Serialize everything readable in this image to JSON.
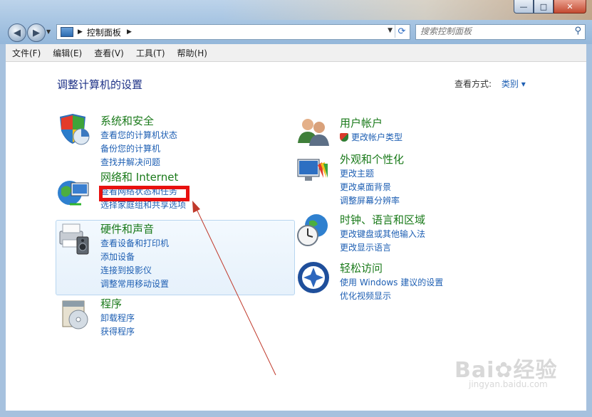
{
  "address": {
    "breadcrumb": "控制面板",
    "search_placeholder": "搜索控制面板"
  },
  "window_buttons": {
    "minimize": "—",
    "maximize": "□",
    "close": "✕"
  },
  "menu": [
    "文件(F)",
    "编辑(E)",
    "查看(V)",
    "工具(T)",
    "帮助(H)"
  ],
  "header": {
    "title": "调整计算机的设置",
    "view_by_label": "查看方式:",
    "view_by_value": "类别 ▾"
  },
  "categories_left": [
    {
      "title": "系统和安全",
      "icon": "shield-chart-icon",
      "links": [
        "查看您的计算机状态",
        "备份您的计算机",
        "查找并解决问题"
      ]
    },
    {
      "title": "网络和 Internet",
      "icon": "globe-network-icon",
      "links": [
        "查看网络状态和任务",
        "选择家庭组和共享选项"
      ]
    },
    {
      "title": "硬件和声音",
      "icon": "printer-speaker-icon",
      "links": [
        "查看设备和打印机",
        "添加设备",
        "连接到投影仪",
        "调整常用移动设置"
      ]
    },
    {
      "title": "程序",
      "icon": "program-disc-icon",
      "links": [
        "卸载程序",
        "获得程序"
      ]
    }
  ],
  "categories_right": [
    {
      "title": "用户帐户",
      "icon": "users-icon",
      "links": [
        "更改帐户类型"
      ]
    },
    {
      "title": "外观和个性化",
      "icon": "monitor-palette-icon",
      "links": [
        "更改主题",
        "更改桌面背景",
        "调整屏幕分辨率"
      ]
    },
    {
      "title": "时钟、语言和区域",
      "icon": "clock-globe-icon",
      "links": [
        "更改键盘或其他输入法",
        "更改显示语言"
      ]
    },
    {
      "title": "轻松访问",
      "icon": "accessibility-icon",
      "links": [
        "使用 Windows 建议的设置",
        "优化视频显示"
      ]
    }
  ],
  "watermark": {
    "brand": "Bai",
    "brand2": "经验",
    "url": "jingyan.baidu.com"
  },
  "colors": {
    "highlight_red": "#e8100f",
    "link_blue": "#1e5fb3",
    "category_green": "#1a7a1a"
  }
}
